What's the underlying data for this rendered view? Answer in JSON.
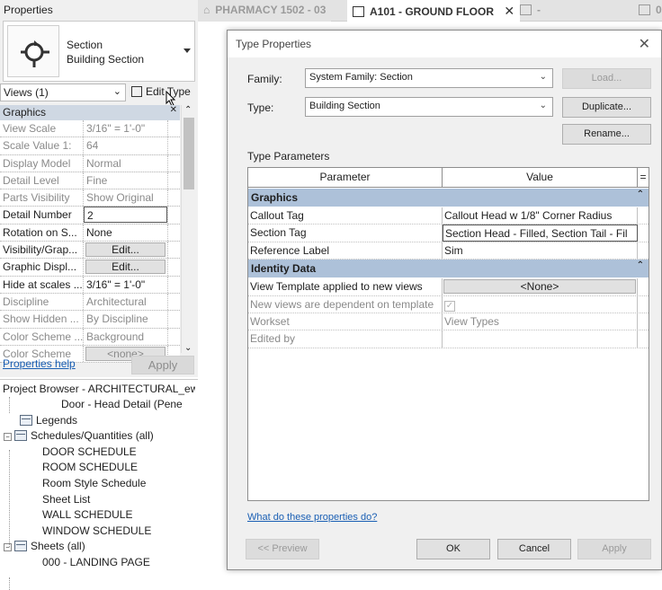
{
  "properties_panel": {
    "title": "Properties",
    "type_family": "Section",
    "type_name": "Building Section",
    "views_filter": "Views (1)",
    "edit_type_label": "Edit Type",
    "group_header": "Graphics",
    "rows": [
      {
        "name": "View Scale",
        "value": "3/16\" = 1'-0\"",
        "readonly": true
      },
      {
        "name": "Scale Value    1:",
        "value": "64",
        "readonly": true
      },
      {
        "name": "Display Model",
        "value": "Normal",
        "readonly": true
      },
      {
        "name": "Detail Level",
        "value": "Fine",
        "readonly": true
      },
      {
        "name": "Parts Visibility",
        "value": "Show Original",
        "readonly": true
      },
      {
        "name": "Detail Number",
        "value": "2",
        "readonly": false,
        "boxed": true
      },
      {
        "name": "Rotation on S...",
        "value": "None",
        "readonly": false
      },
      {
        "name": "Visibility/Grap...",
        "value": "Edit...",
        "readonly": false,
        "button": true
      },
      {
        "name": "Graphic Displ...",
        "value": "Edit...",
        "readonly": false,
        "button": true
      },
      {
        "name": "Hide at scales ...",
        "value": "3/16\" = 1'-0\"",
        "readonly": false
      },
      {
        "name": "Discipline",
        "value": "Architectural",
        "readonly": true
      },
      {
        "name": "Show Hidden ...",
        "value": "By Discipline",
        "readonly": true
      },
      {
        "name": "Color Scheme ...",
        "value": "Background",
        "readonly": true
      },
      {
        "name": "Color Scheme",
        "value": "<none>",
        "readonly": true,
        "button": true
      }
    ],
    "help_link": "Properties help",
    "apply_label": "Apply"
  },
  "project_browser": {
    "title": "Project Browser - ARCHITECTURAL_ew...",
    "items": [
      {
        "label": "Door - Head Detail (Pene",
        "indent": 68,
        "icon": false,
        "toggle": null
      },
      {
        "label": "Legends",
        "indent": 22,
        "icon": true,
        "toggle": null
      },
      {
        "label": "Schedules/Quantities (all)",
        "indent": 4,
        "icon": true,
        "toggle": "−"
      },
      {
        "label": "DOOR SCHEDULE",
        "indent": 47,
        "icon": false,
        "toggle": null
      },
      {
        "label": "ROOM SCHEDULE",
        "indent": 47,
        "icon": false,
        "toggle": null
      },
      {
        "label": "Room Style Schedule",
        "indent": 47,
        "icon": false,
        "toggle": null
      },
      {
        "label": "Sheet List",
        "indent": 47,
        "icon": false,
        "toggle": null
      },
      {
        "label": "WALL SCHEDULE",
        "indent": 47,
        "icon": false,
        "toggle": null
      },
      {
        "label": "WINDOW SCHEDULE",
        "indent": 47,
        "icon": false,
        "toggle": null
      },
      {
        "label": "Sheets (all)",
        "indent": 4,
        "icon": true,
        "toggle": "−"
      },
      {
        "label": "000 - LANDING PAGE",
        "indent": 47,
        "icon": false,
        "toggle": null
      }
    ]
  },
  "view_tabs": [
    {
      "label": "PHARMACY 1502 - 03",
      "active": false,
      "icon": "house-icon"
    },
    {
      "label": "A101 - GROUND FLOOR",
      "active": true,
      "icon": "floorplan-icon"
    },
    {
      "label": "-",
      "active": false,
      "icon": "floorplan-icon"
    },
    {
      "label": "0",
      "active": false,
      "icon": "floorplan-icon"
    }
  ],
  "dialog": {
    "title": "Type Properties",
    "family_label": "Family:",
    "family_value": "System Family: Section",
    "type_label": "Type:",
    "type_value": "Building Section",
    "load_label": "Load...",
    "duplicate_label": "Duplicate...",
    "rename_label": "Rename...",
    "type_params_label": "Type Parameters",
    "col_parameter": "Parameter",
    "col_value": "Value",
    "col_eq": "=",
    "groups": [
      {
        "name": "Graphics",
        "rows": [
          {
            "name": "Callout Tag",
            "value": "Callout Head w 1/8\" Corner Radius",
            "readonly": false
          },
          {
            "name": "Section Tag",
            "value": "Section Head - Filled, Section Tail - Fil",
            "readonly": false,
            "selected": true
          },
          {
            "name": "Reference Label",
            "value": "Sim",
            "readonly": false
          }
        ]
      },
      {
        "name": "Identity Data",
        "rows": [
          {
            "name": "View Template applied to new views",
            "value": "<None>",
            "readonly": false,
            "button": true
          },
          {
            "name": "New views are dependent on template",
            "value": "",
            "readonly": true,
            "checkbox": true
          },
          {
            "name": "Workset",
            "value": "View Types",
            "readonly": true
          },
          {
            "name": "Edited by",
            "value": "",
            "readonly": true
          }
        ]
      }
    ],
    "help_link": "What do these properties do?",
    "preview_label": "<< Preview",
    "ok_label": "OK",
    "cancel_label": "Cancel",
    "apply_label": "Apply"
  }
}
